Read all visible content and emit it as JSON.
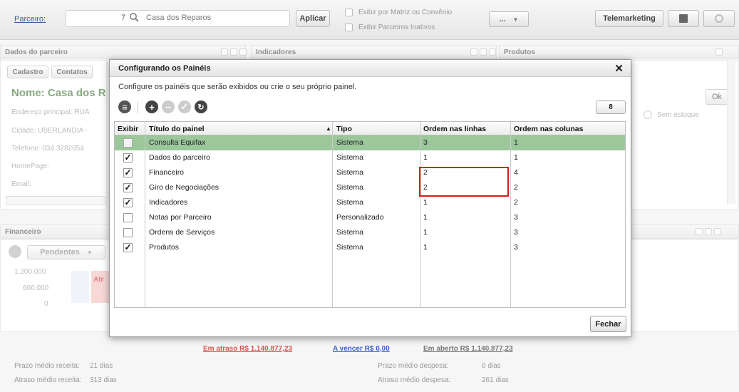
{
  "topbar": {
    "parceiro_label": "Parceiro:",
    "parceiro_code": "7",
    "parceiro_name": "Casa dos Reparos",
    "apply_button": "Aplicar",
    "check_matriz": "Exibir por Matriz ou Convênio",
    "check_inativos": "Exibir Parceiros Inativos",
    "more_button": "...",
    "telemarketing_button": "Telemarketing"
  },
  "background": {
    "panel_dados": "Dados do parceiro",
    "panel_indicadores": "Indicadores",
    "panel_produtos": "Produtos",
    "tab_cadastro": "Cadastro",
    "tab_contatos": "Contatos",
    "nome": "Nome: Casa dos R",
    "endereco": "Endereço principal: RUA",
    "cidade": "Cidade: UBERLANDIA -",
    "telefone": "Telefone: 034 3282654",
    "homepage": "HomePage:",
    "email": "Email:",
    "ok_button": "Ok",
    "sem_estoque": "Sem estoque",
    "panel_financeiro": "Financeiro",
    "pendentes": "Pendentes",
    "y_ticks": [
      "1.200.000",
      "600.000",
      "0"
    ],
    "bar_label": "Atr"
  },
  "modal": {
    "title": "Configurando os Painéis",
    "description": "Configure os painéis que serão exibidos ou crie o seu próprio painel.",
    "count": "8",
    "columns": [
      "Exibir",
      "Título do painel",
      "Tipo",
      "Ordem nas linhas",
      "Ordem nas colunas"
    ],
    "rows": [
      {
        "exibir": false,
        "titulo": "Consulta Equifax",
        "tipo": "Sistema",
        "linha": "3",
        "coluna": "1",
        "selected": true
      },
      {
        "exibir": true,
        "titulo": "Dados do parceiro",
        "tipo": "Sistema",
        "linha": "1",
        "coluna": "1"
      },
      {
        "exibir": true,
        "titulo": "Financeiro",
        "tipo": "Sistema",
        "linha": "2",
        "coluna": "4"
      },
      {
        "exibir": true,
        "titulo": "Giro de Negociações",
        "tipo": "Sistema",
        "linha": "2",
        "coluna": "2"
      },
      {
        "exibir": true,
        "titulo": "Indicadores",
        "tipo": "Sistema",
        "linha": "1",
        "coluna": "2"
      },
      {
        "exibir": false,
        "titulo": "Notas por Parceiro",
        "tipo": "Personalizado",
        "linha": "1",
        "coluna": "3"
      },
      {
        "exibir": false,
        "titulo": "Ordens de Serviços",
        "tipo": "Sistema",
        "linha": "1",
        "coluna": "3"
      },
      {
        "exibir": true,
        "titulo": "Produtos",
        "tipo": "Sistema",
        "linha": "1",
        "coluna": "3"
      }
    ],
    "close_button": "Fechar"
  },
  "footer": {
    "em_atraso": "Em atraso R$ 1.140.877,23",
    "a_vencer": "A vencer R$ 0,00",
    "em_aberto": "Em aberto R$ 1.140.877,23",
    "prazo_receita_label": "Prazo médio receita:",
    "prazo_receita_value": "21 dias",
    "atraso_receita_label": "Atraso médio receita:",
    "atraso_receita_value": "313 dias",
    "prazo_despesa_label": "Prazo médio despesa:",
    "prazo_despesa_value": "0 dias",
    "atraso_despesa_label": "Atraso médio despesa:",
    "atraso_despesa_value": "261 dias"
  },
  "colors": {
    "selected_row": "#9bc79b",
    "highlight": "#e01818",
    "link_red": "#d9534f",
    "link_blue": "#3b5fc0"
  }
}
